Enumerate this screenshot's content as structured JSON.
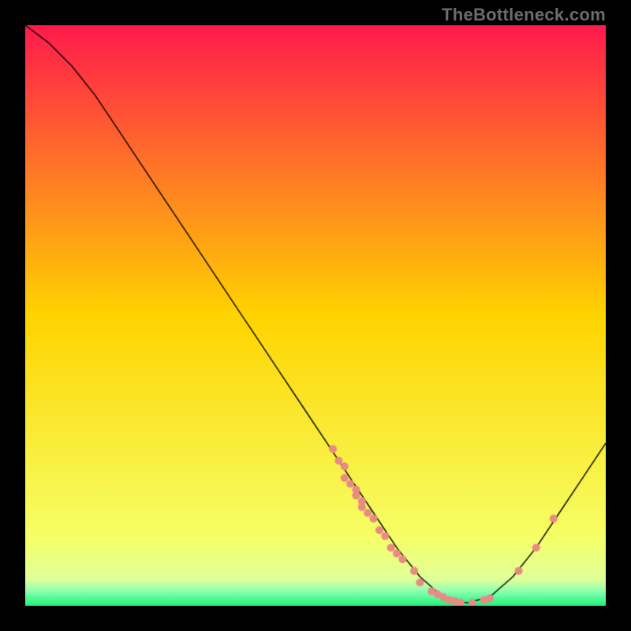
{
  "watermark": "TheBottleneck.com",
  "chart_data": {
    "type": "line",
    "title": "",
    "xlabel": "",
    "ylabel": "",
    "xlim": [
      0,
      100
    ],
    "ylim": [
      0,
      100
    ],
    "grid": false,
    "legend": false,
    "background_gradient": {
      "top": "#ff1a4d",
      "mid1": "#ffd400",
      "mid2": "#f6ff66",
      "bottom": "#1df27a"
    },
    "curve": {
      "color": "#000000",
      "width": 1.4,
      "points": [
        {
          "x": 0,
          "y": 100
        },
        {
          "x": 4,
          "y": 97
        },
        {
          "x": 8,
          "y": 93
        },
        {
          "x": 12,
          "y": 88
        },
        {
          "x": 16,
          "y": 82
        },
        {
          "x": 20,
          "y": 76
        },
        {
          "x": 24,
          "y": 70
        },
        {
          "x": 28,
          "y": 64
        },
        {
          "x": 32,
          "y": 58
        },
        {
          "x": 36,
          "y": 52
        },
        {
          "x": 40,
          "y": 46
        },
        {
          "x": 44,
          "y": 40
        },
        {
          "x": 48,
          "y": 34
        },
        {
          "x": 52,
          "y": 28
        },
        {
          "x": 56,
          "y": 22
        },
        {
          "x": 60,
          "y": 16
        },
        {
          "x": 64,
          "y": 10
        },
        {
          "x": 68,
          "y": 5
        },
        {
          "x": 72,
          "y": 1.5
        },
        {
          "x": 76,
          "y": 0.5
        },
        {
          "x": 80,
          "y": 1.5
        },
        {
          "x": 84,
          "y": 5
        },
        {
          "x": 88,
          "y": 10
        },
        {
          "x": 92,
          "y": 16
        },
        {
          "x": 96,
          "y": 22
        },
        {
          "x": 100,
          "y": 28
        }
      ]
    },
    "scatter": {
      "color": "#e98a84",
      "radius": 5,
      "points": [
        {
          "x": 53,
          "y": 27
        },
        {
          "x": 54,
          "y": 25
        },
        {
          "x": 55,
          "y": 24
        },
        {
          "x": 55,
          "y": 22
        },
        {
          "x": 56,
          "y": 21
        },
        {
          "x": 57,
          "y": 20
        },
        {
          "x": 57,
          "y": 19
        },
        {
          "x": 58,
          "y": 18
        },
        {
          "x": 58,
          "y": 17
        },
        {
          "x": 59,
          "y": 16
        },
        {
          "x": 60,
          "y": 15
        },
        {
          "x": 61,
          "y": 13
        },
        {
          "x": 62,
          "y": 12
        },
        {
          "x": 63,
          "y": 10
        },
        {
          "x": 64,
          "y": 9
        },
        {
          "x": 65,
          "y": 8
        },
        {
          "x": 67,
          "y": 6
        },
        {
          "x": 68,
          "y": 4
        },
        {
          "x": 70,
          "y": 2.5
        },
        {
          "x": 71,
          "y": 2
        },
        {
          "x": 72,
          "y": 1.5
        },
        {
          "x": 73,
          "y": 1
        },
        {
          "x": 74,
          "y": 0.8
        },
        {
          "x": 75,
          "y": 0.5
        },
        {
          "x": 77,
          "y": 0.5
        },
        {
          "x": 79,
          "y": 1
        },
        {
          "x": 80,
          "y": 1.3
        },
        {
          "x": 85,
          "y": 6
        },
        {
          "x": 88,
          "y": 10
        },
        {
          "x": 91,
          "y": 15
        }
      ]
    }
  }
}
